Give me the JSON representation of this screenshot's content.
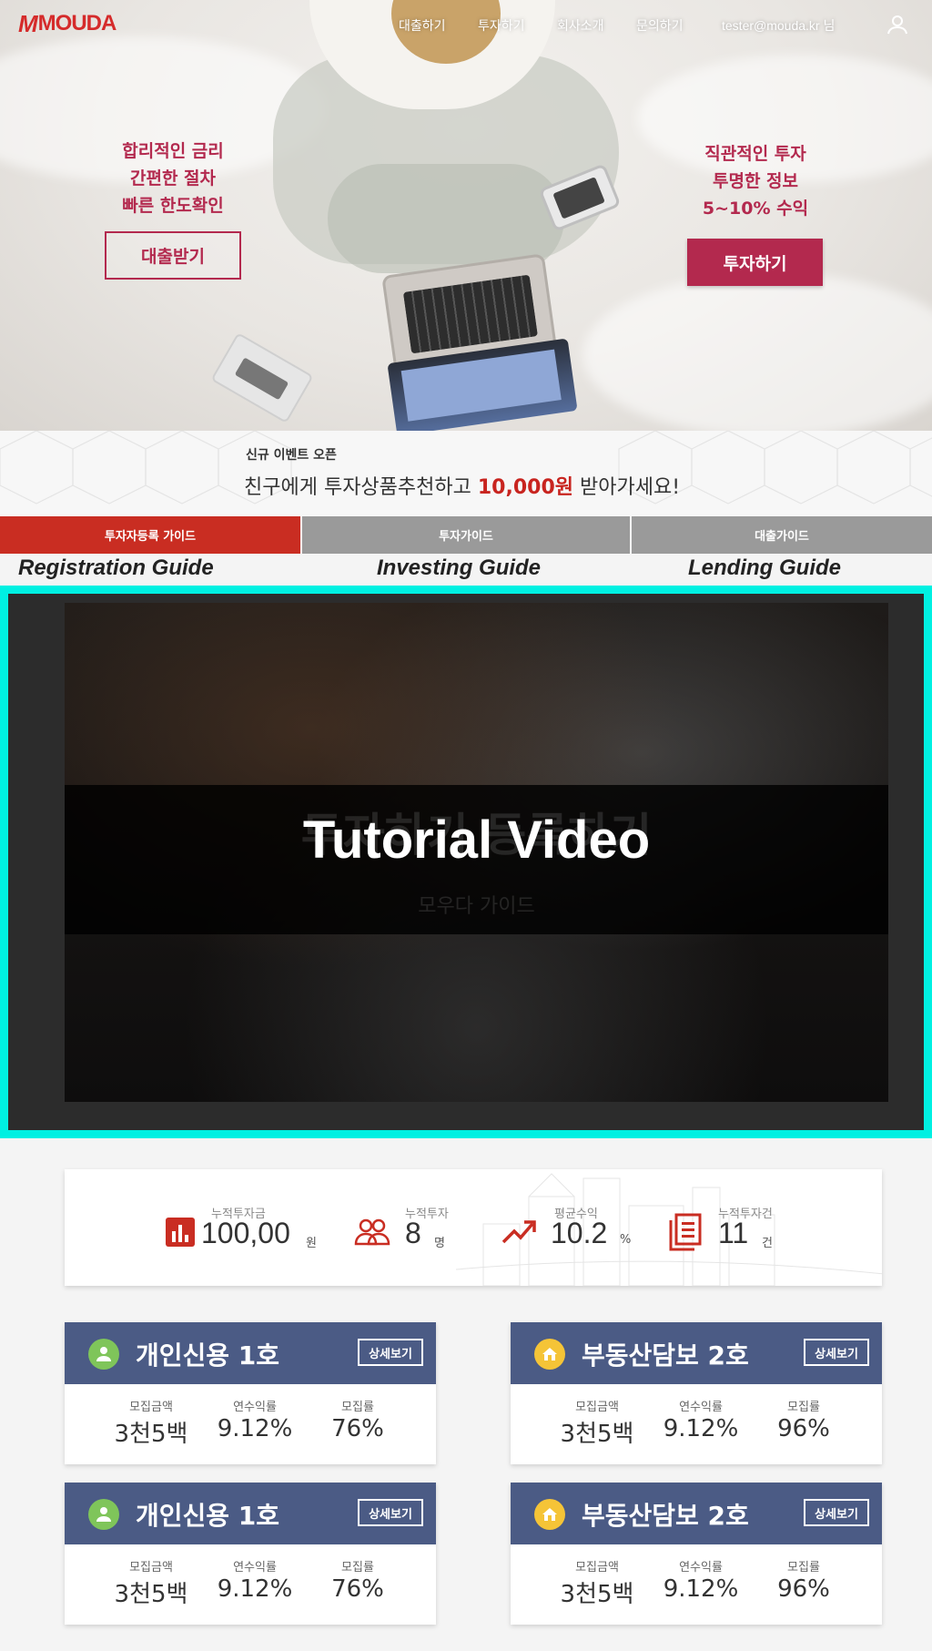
{
  "header": {
    "logo_mark": "M",
    "logo_text": "MOUDA",
    "nav": [
      "대출하기",
      "투자하기",
      "회사소개",
      "문의하기"
    ],
    "user_email": "tester@mouda.kr 님"
  },
  "hero": {
    "left_lines": [
      "합리적인 금리",
      "간편한 절차",
      "빠른 한도확인"
    ],
    "left_button": "대출받기",
    "right_lines": [
      "직관적인 투자",
      "투명한 정보",
      "5~10% 수익"
    ],
    "right_button": "투자하기"
  },
  "event": {
    "small": "신규 이벤트 오픈",
    "before": "친구에게 투자상품추천하고 ",
    "amount": "10,000원",
    "after": " 받아가세요!"
  },
  "guide": {
    "tabs": [
      "투자자등록 가이드",
      "투자가이드",
      "대출가이드"
    ],
    "labels": [
      "Registration Guide",
      "Investing Guide",
      "Lending Guide"
    ]
  },
  "video": {
    "title": "Tutorial Video",
    "ghost_title": "투자하기 등록하기",
    "ghost_sub": "모우다 가이드"
  },
  "stats": [
    {
      "label": "누적투자금",
      "value": "100,00",
      "unit": "원",
      "icon": "bar-chart-icon"
    },
    {
      "label": "누적투자",
      "value": "8",
      "unit": "명",
      "icon": "people-icon"
    },
    {
      "label": "평균수익",
      "value": "10.2",
      "unit": "%",
      "icon": "trending-up-icon"
    },
    {
      "label": "누적투자건",
      "value": "11",
      "unit": "건",
      "icon": "documents-icon"
    }
  ],
  "cards": [
    {
      "title": "개인신용 1호",
      "type": "person",
      "button": "상세보기",
      "amount_label": "모집금액",
      "amount": "3천5백",
      "rate_label": "연수익률",
      "rate": "9.12%",
      "progress_label": "모집률",
      "progress": "76%"
    },
    {
      "title": "부동산담보 2호",
      "type": "home",
      "button": "상세보기",
      "amount_label": "모집금액",
      "amount": "3천5백",
      "rate_label": "연수익률",
      "rate": "9.12%",
      "progress_label": "모집률",
      "progress": "96%"
    },
    {
      "title": "개인신용 1호",
      "type": "person",
      "button": "상세보기",
      "amount_label": "모집금액",
      "amount": "3천5백",
      "rate_label": "연수익률",
      "rate": "9.12%",
      "progress_label": "모집률",
      "progress": "76%"
    },
    {
      "title": "부동산담보 2호",
      "type": "home",
      "button": "상세보기",
      "amount_label": "모집금액",
      "amount": "3천5백",
      "rate_label": "연수익률",
      "rate": "9.12%",
      "progress_label": "모집률",
      "progress": "96%"
    }
  ],
  "colors": {
    "brand_red": "#d52b2b",
    "promo_pink": "#b3294e",
    "card_header": "#4b5b85",
    "video_border": "#00f0e2"
  }
}
